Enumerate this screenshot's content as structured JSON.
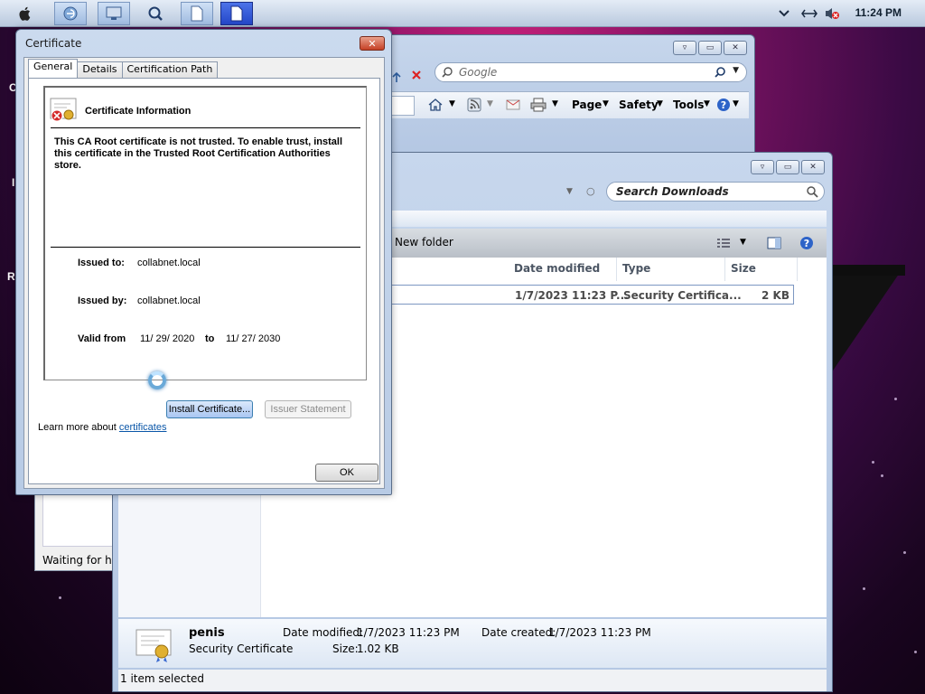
{
  "menubar": {
    "clock": "11:24 PM",
    "icons": [
      "apple-icon",
      "ie-icon",
      "monitor-icon",
      "search-icon",
      "document-icon",
      "document-active-icon"
    ],
    "tray_icons": [
      "chevron-down-icon",
      "network-icon",
      "volume-muted-icon"
    ]
  },
  "desktop": {
    "letters": [
      "C",
      "I",
      "R"
    ]
  },
  "ie_window": {
    "search_placeholder": "Google",
    "toolbar": {
      "page": "Page",
      "safety": "Safety",
      "tools": "Tools"
    }
  },
  "loading_window": {
    "status": "Waiting for htt"
  },
  "explorer": {
    "search_placeholder": "Search Downloads",
    "new_folder": "New folder",
    "columns": [
      "Date modified",
      "Type",
      "Size"
    ],
    "file": {
      "date": "1/7/2023 11:23 P...",
      "type": "Security Certifica...",
      "size": "2 KB"
    },
    "details": {
      "name": "penis",
      "kind": "Security Certificate",
      "date_modified_label": "Date modified:",
      "date_modified": "1/7/2023 11:23 PM",
      "date_created_label": "Date created:",
      "date_created": "1/7/2023 11:23 PM",
      "size_label": "Size:",
      "size": "1.02 KB"
    },
    "status": "1 item selected"
  },
  "certificate_dialog": {
    "title": "Certificate",
    "tabs": [
      "General",
      "Details",
      "Certification Path"
    ],
    "info_title": "Certificate Information",
    "message": "This CA Root certificate is not trusted. To enable trust, install this certificate in the Trusted Root Certification Authorities store.",
    "issued_to_label": "Issued to:",
    "issued_to": "collabnet.local",
    "issued_by_label": "Issued by:",
    "issued_by": "collabnet.local",
    "valid_from_label": "Valid from",
    "valid_from": "11/ 29/ 2020",
    "valid_to_label": "to",
    "valid_to": "11/ 27/ 2030",
    "install_button": "Install Certificate...",
    "issuer_button": "Issuer Statement",
    "learn_more": "Learn more about",
    "learn_link": "certificates",
    "ok_button": "OK"
  }
}
